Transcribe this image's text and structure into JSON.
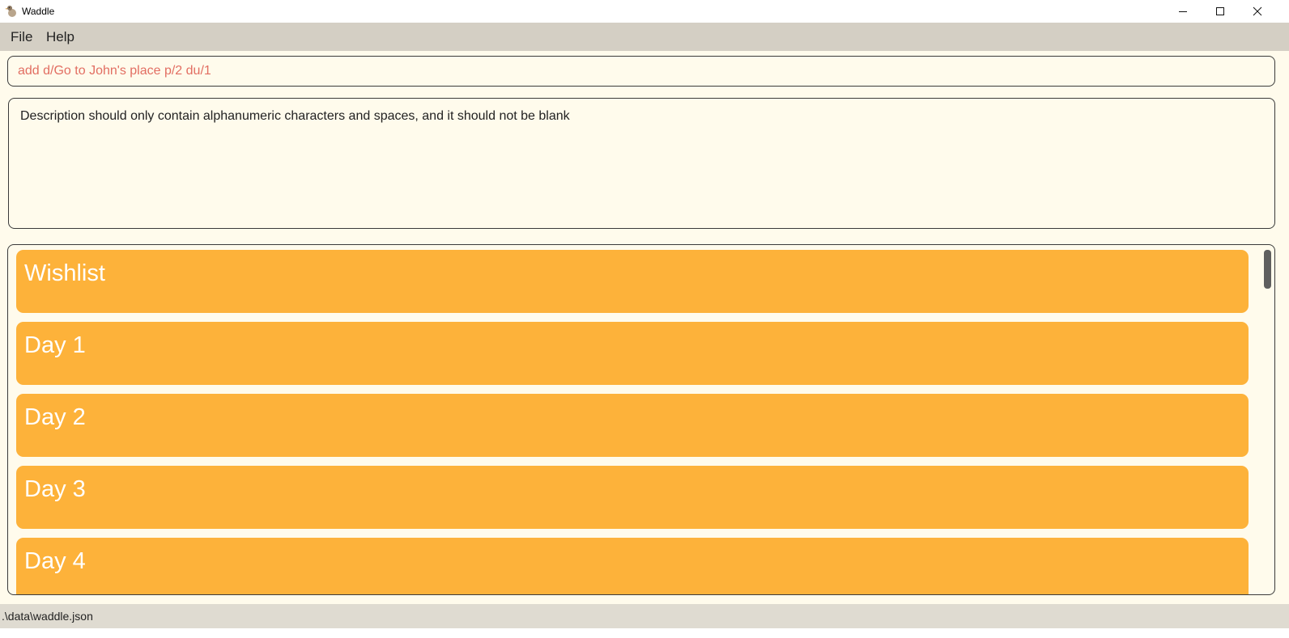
{
  "window": {
    "title": "Waddle",
    "controls": [
      "minimize",
      "maximize",
      "close"
    ]
  },
  "menu": {
    "items": [
      {
        "label": "File"
      },
      {
        "label": "Help"
      }
    ]
  },
  "command": {
    "value": "add d/Go to John's place p/2 du/1",
    "text_color": "#e26e62"
  },
  "result": {
    "message": "Description should only contain alphanumeric characters and spaces, and it should not be blank"
  },
  "itinerary": {
    "card_color": "#fdb23a",
    "items": [
      {
        "label": "Wishlist"
      },
      {
        "label": "Day 1"
      },
      {
        "label": "Day 2"
      },
      {
        "label": "Day 3"
      },
      {
        "label": "Day 4"
      }
    ]
  },
  "status": {
    "file_path": ".\\data\\waddle.json"
  }
}
